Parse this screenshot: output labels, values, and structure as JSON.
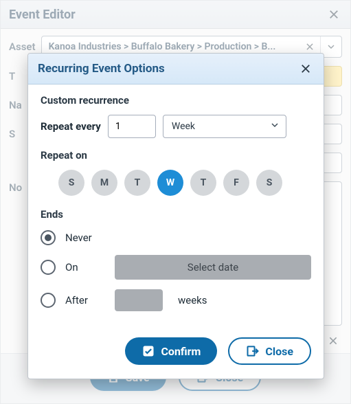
{
  "editor": {
    "title": "Event Editor",
    "asset_label": "Asset",
    "asset_value": "Kanoa Industries > Buffalo Bakery > Production > B...",
    "row_t_label": "T",
    "row_na_label": "Na",
    "row_s_label": "S",
    "row_no_label": "No",
    "save_label": "Save",
    "close_label": "Close"
  },
  "modal": {
    "title": "Recurring Event Options",
    "custom_heading": "Custom recurrence",
    "repeat_label": "Repeat every",
    "repeat_value": "1",
    "unit_value": "Week",
    "repeat_on_heading": "Repeat on",
    "days": [
      {
        "label": "S",
        "selected": false
      },
      {
        "label": "M",
        "selected": false
      },
      {
        "label": "T",
        "selected": false
      },
      {
        "label": "W",
        "selected": true
      },
      {
        "label": "T",
        "selected": false
      },
      {
        "label": "F",
        "selected": false
      },
      {
        "label": "S",
        "selected": false
      }
    ],
    "ends_heading": "Ends",
    "opt_never": "Never",
    "opt_on": "On",
    "opt_after": "After",
    "select_date_placeholder": "Select date",
    "weeks_label": "weeks",
    "selected_end": "never",
    "confirm_label": "Confirm",
    "close_label": "Close"
  }
}
